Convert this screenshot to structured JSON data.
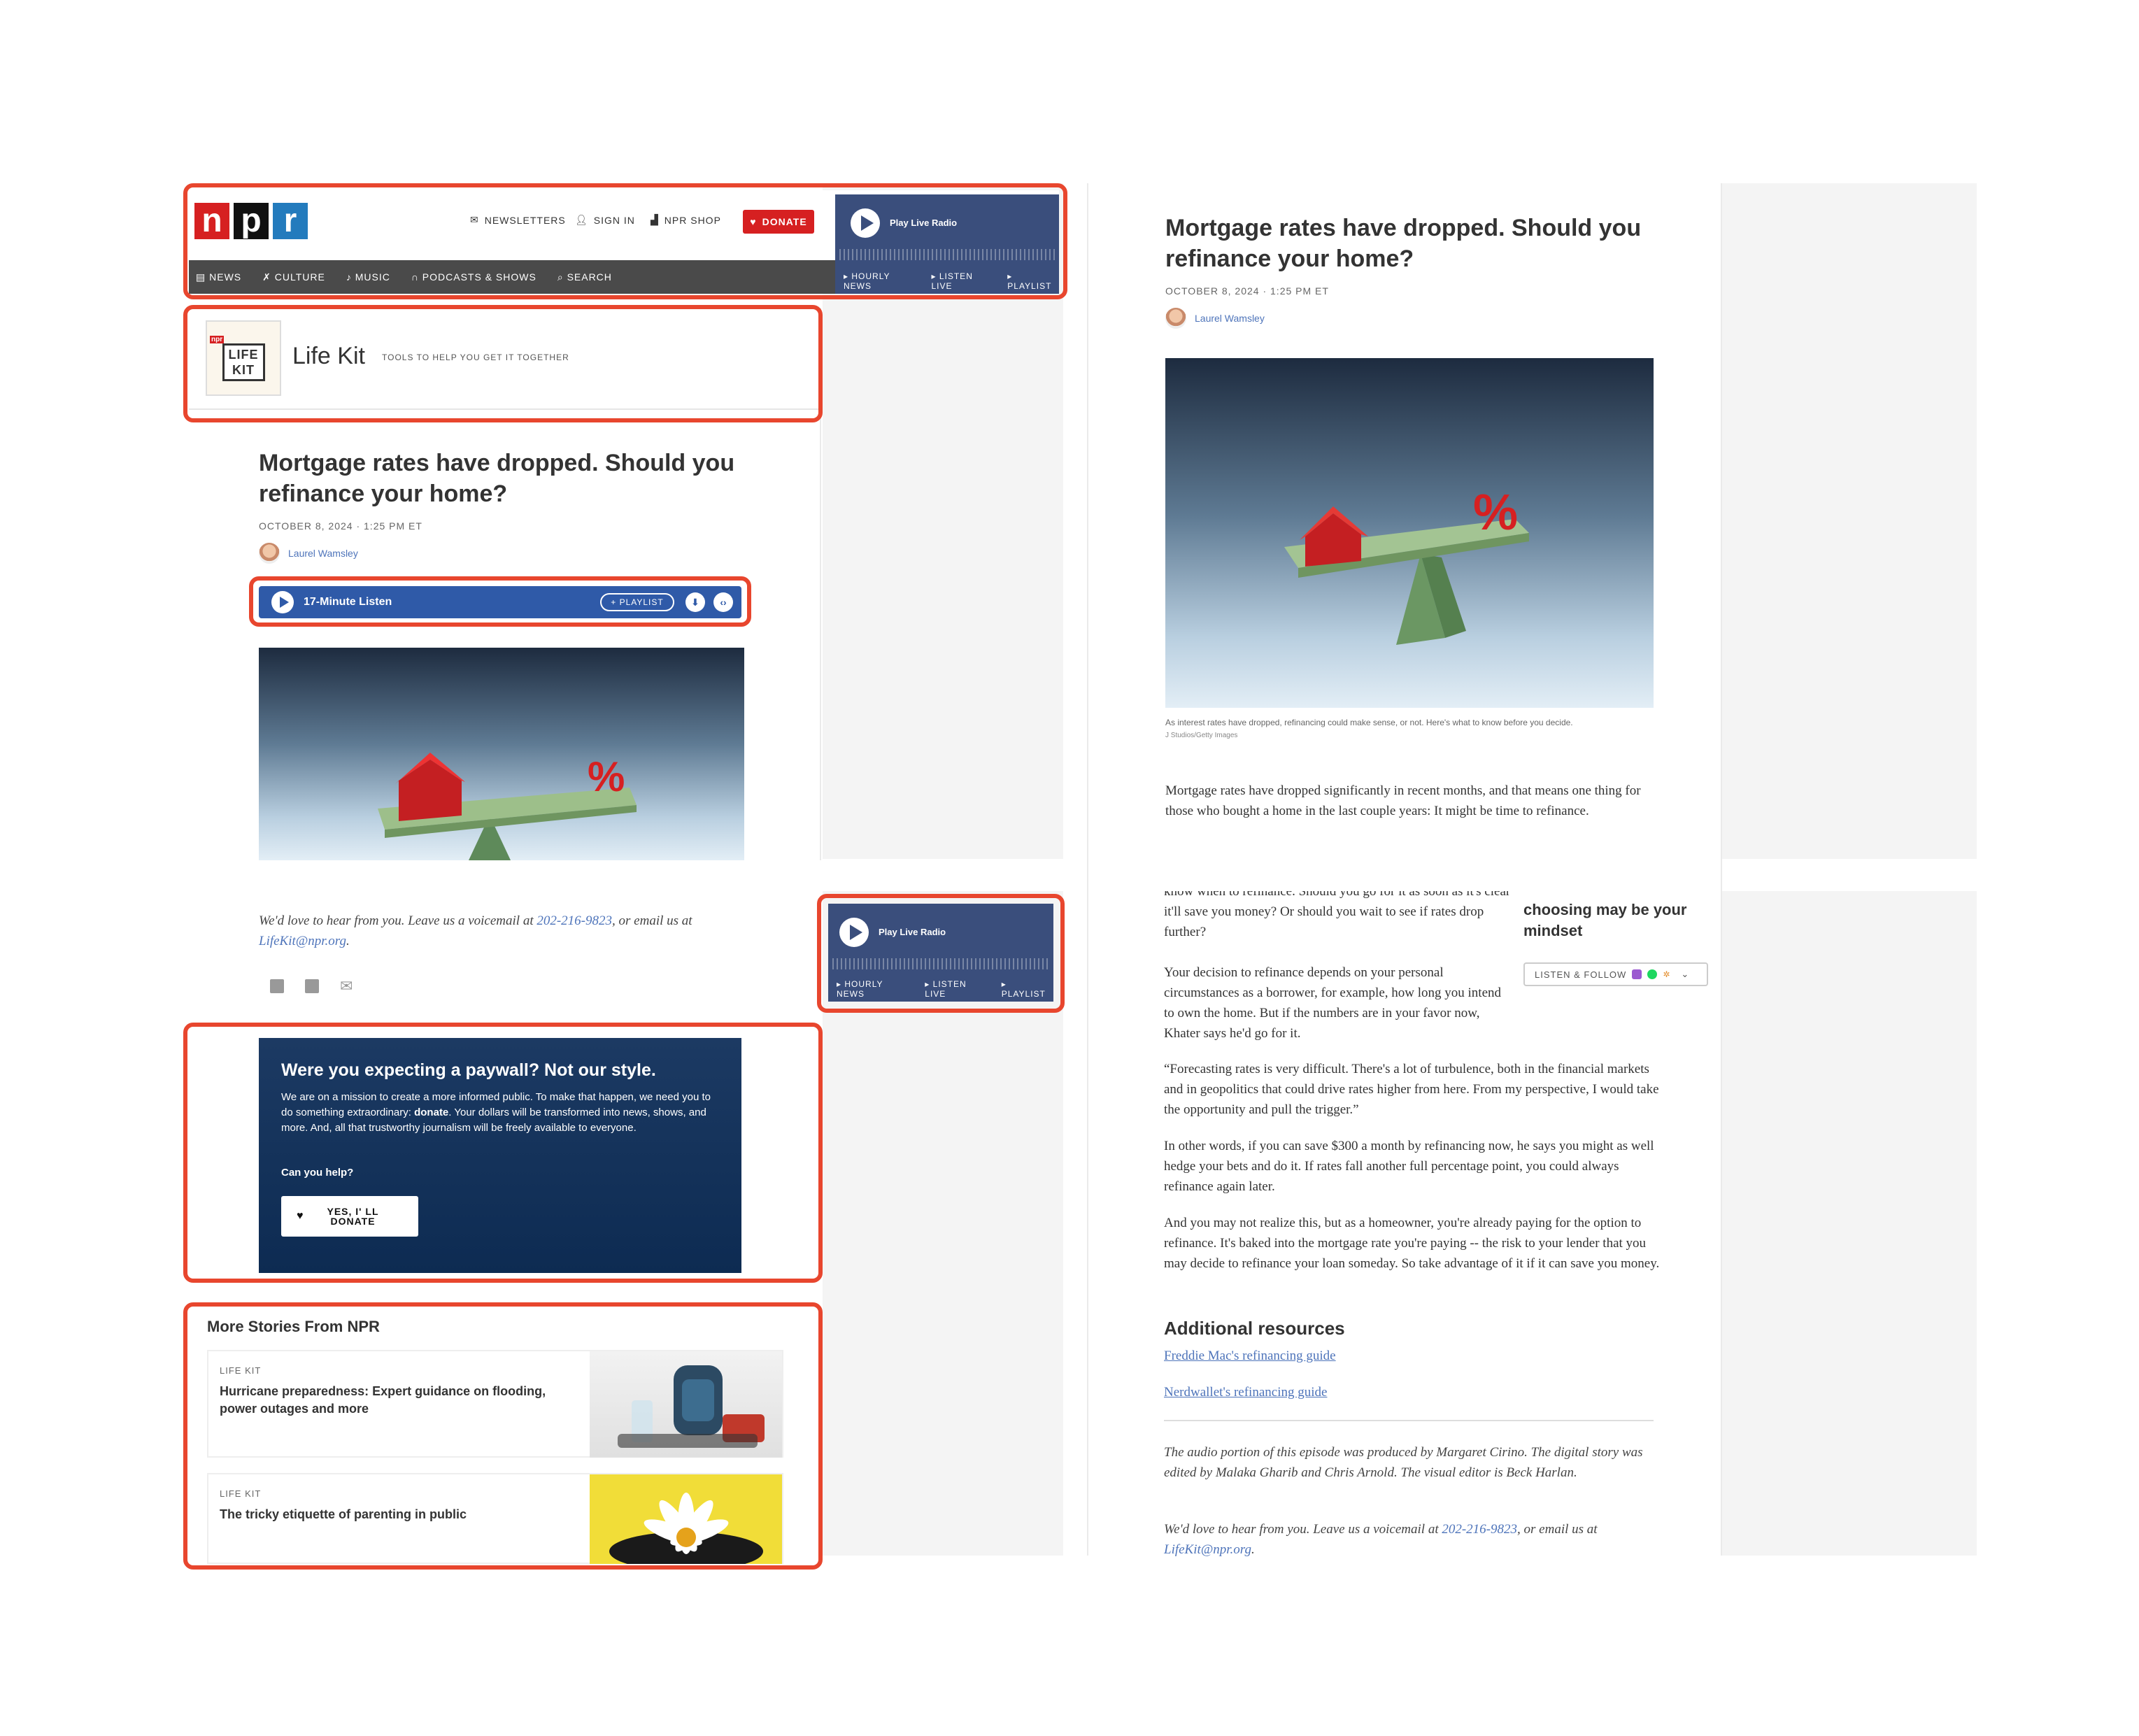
{
  "header": {
    "logo_letters": [
      "n",
      "p",
      "r"
    ],
    "newsletters": "NEWSLETTERS",
    "sign_in": "SIGN IN",
    "npr_shop": "NPR SHOP",
    "donate": "DONATE",
    "nav": [
      "NEWS",
      "CULTURE",
      "MUSIC",
      "PODCASTS & SHOWS",
      "SEARCH"
    ]
  },
  "radio": {
    "play_label": "Play Live Radio",
    "links": [
      "HOURLY NEWS",
      "LISTEN LIVE",
      "PLAYLIST"
    ]
  },
  "lifekit": {
    "logo_badge": "npr",
    "logo_line1": "LIFE",
    "logo_line2": "KIT",
    "name": "Life Kit",
    "tagline": "TOOLS TO HELP YOU GET IT TOGETHER"
  },
  "article": {
    "title": "Mortgage rates have dropped. Should you refinance your home?",
    "date": "OCTOBER 8, 2024 · 1:25 PM ET",
    "author": "Laurel Wamsley",
    "listen_label": "17-Minute Listen",
    "playlist_label": "+ PLAYLIST",
    "image_caption": "As interest rates have dropped, refinancing could make sense, or not. Here's what to know before you decide.",
    "image_credit": "J Studios/Getty Images",
    "p1": "Mortgage rates have dropped significantly in recent months, and that means one thing for those who bought a home in the last couple years: It might be time to refinance.",
    "p_cut": "know when to refinance. Should you go for it as soon as it's clear it'll save you money? Or should you wait to see if rates drop further?",
    "p2": "Your decision to refinance depends on your personal circumstances as a borrower, for example, how long you intend to own the home. But if the numbers are in your favor now, Khater says he'd go for it.",
    "p3": "“Forecasting rates is very difficult. There's a lot of turbulence, both in the financial markets and in geopolitics that could drive rates higher from here. From my perspective, I would take the opportunity and pull the trigger.”",
    "p4": "In other words, if you can save $300 a month by refinancing now, he says you might as well hedge your bets and do it. If rates fall another full percentage point, you could always refinance again later.",
    "p5": "And you may not realize this, but as a homeowner, you're already paying for the option to refinance. It's baked into the mortgage rate you're paying -- the risk to your lender that you may decide to refinance your loan someday. So take advantage of it if it can save you money.",
    "resources_heading": "Additional resources",
    "resource1": "Freddie Mac's refinancing guide",
    "resource2": "Nerdwallet's refinancing guide",
    "credits": "The audio portion of this episode was produced by Margaret Cirino. The digital story was edited by Malaka Gharib and Chris Arnold. The visual editor is Beck Harlan.",
    "voicemail_pre": "We'd love to hear from you. Leave us a voicemail at ",
    "phone": "202-216-9823",
    "voicemail_mid": ", or email us at ",
    "email": "LifeKit@npr.org",
    "voicemail_end": "."
  },
  "sidebar": {
    "promo_title": "choosing may be your mindset",
    "listen_follow": "LISTEN & FOLLOW"
  },
  "paywall": {
    "heading": "Were you expecting a paywall? Not our style.",
    "body_pre": "We are on a mission to create a more informed public. To make that happen, we need you to do something extraordinary: ",
    "body_bold": "donate",
    "body_post": ". Your dollars will be transformed into news, shows, and more. And, all that trustworthy journalism will be freely available to everyone.",
    "question": "Can you help?",
    "button_line1": "YES, I' LL",
    "button_line2": "DONATE"
  },
  "more_stories": {
    "heading": "More Stories From NPR",
    "items": [
      {
        "kicker": "LIFE KIT",
        "title": "Hurricane preparedness: Expert guidance on flooding, power outages and more"
      },
      {
        "kicker": "LIFE KIT",
        "title": "The tricky etiquette of parenting in public"
      }
    ]
  },
  "colors": {
    "accent_red": "#e8462e",
    "npr_red": "#d62021",
    "npr_blue": "#237bbd",
    "radio_blue": "#3a4e7c",
    "audio_blue": "#2f5aa8"
  }
}
